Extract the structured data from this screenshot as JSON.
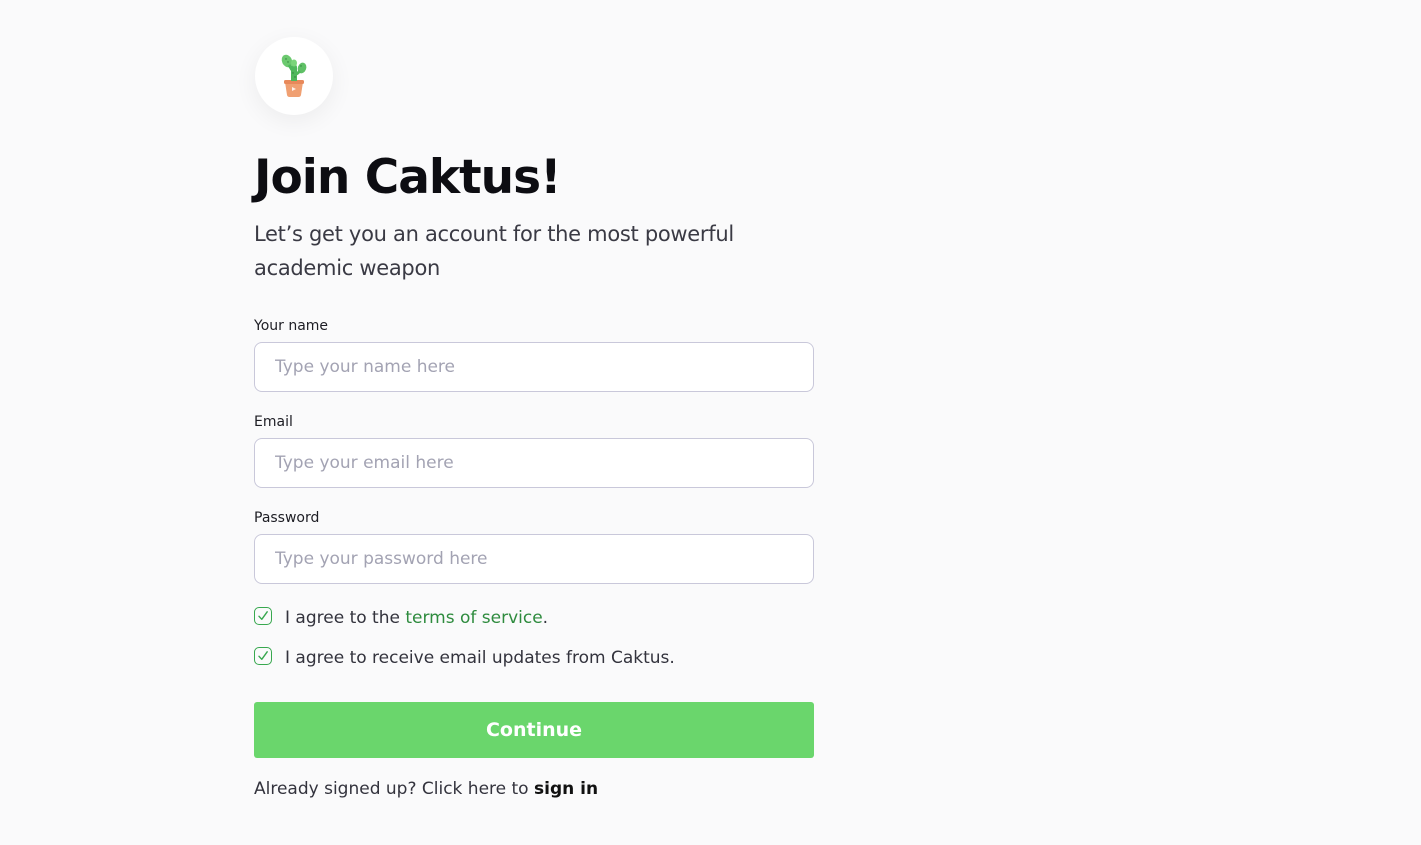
{
  "brand": {
    "logo_icon": "cactus-in-pot-icon",
    "accent_color": "#6ad66c",
    "link_color": "#2e8b3e"
  },
  "heading": {
    "title": "Join Caktus!",
    "subtitle": "Let’s get you an account for the most powerful academic weapon"
  },
  "form": {
    "name": {
      "label": "Your name",
      "placeholder": "Type your name here",
      "value": ""
    },
    "email": {
      "label": "Email",
      "placeholder": "Type your email here",
      "value": ""
    },
    "password": {
      "label": "Password",
      "placeholder": "Type your password here",
      "value": ""
    },
    "terms_checkbox": {
      "checked": true,
      "text_before": "I agree to the ",
      "link_text": "terms of service",
      "text_after": "."
    },
    "updates_checkbox": {
      "checked": true,
      "text": "I agree to receive email updates from Caktus."
    },
    "submit_label": "Continue"
  },
  "footer": {
    "prompt": "Already signed up? Click here to ",
    "signin_label": "sign in"
  }
}
